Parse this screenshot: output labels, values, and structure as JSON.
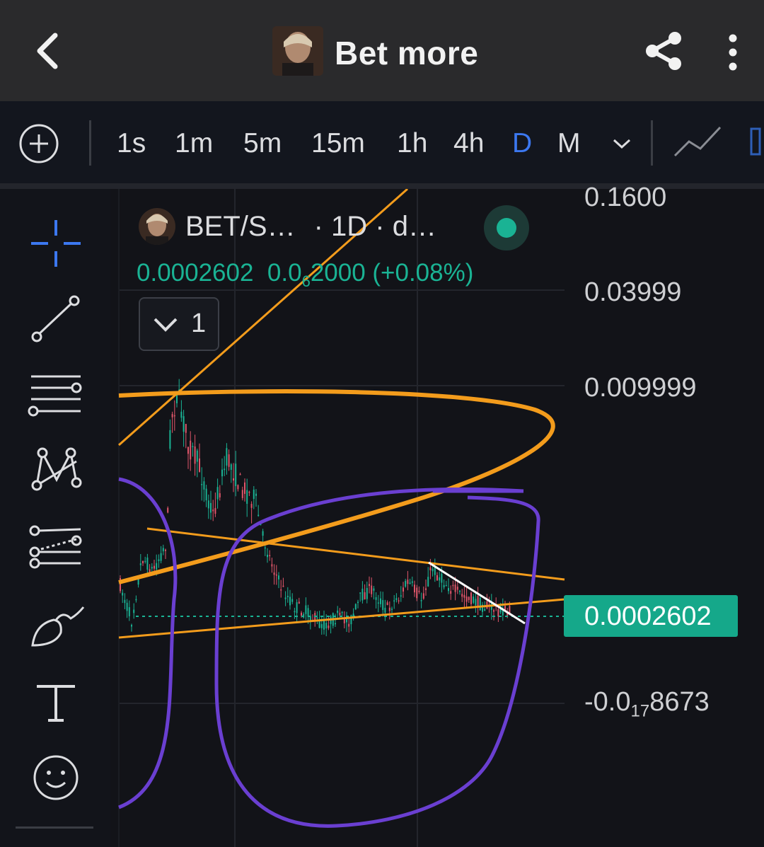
{
  "header": {
    "title": "Bet more",
    "back_icon": "chevron-left-icon",
    "share_icon": "share-icon",
    "more_icon": "more-vertical-icon"
  },
  "timeframes": {
    "items": [
      "1s",
      "1m",
      "5m",
      "15m",
      "1h",
      "4h",
      "D",
      "M"
    ],
    "active": "D"
  },
  "toolbar_icons": [
    "crosshair-icon",
    "trend-line-icon",
    "horizontal-lines-icon",
    "pattern-icon",
    "fib-icon",
    "brush-icon",
    "text-icon",
    "emoji-icon"
  ],
  "legend": {
    "symbol": "BET/S…",
    "interval": "· 1D · d…",
    "price": "0.0002602",
    "change_prefix": "0.0",
    "change_sub": "6",
    "change_suffix": "2000 (+0.08%)",
    "collapse_count": "1"
  },
  "price_axis": {
    "labels": [
      "0.1600",
      "0.03999",
      "0.009999"
    ],
    "neg_prefix": "-0.0",
    "neg_sub": "17",
    "neg_suffix": "8673",
    "current_price": "0.0002602"
  },
  "colors": {
    "up": "#1ab394",
    "down": "#e0566a",
    "accent": "#3c78f0",
    "orange_drawing": "#f39c1c",
    "purple_drawing": "#6a3fd1"
  }
}
